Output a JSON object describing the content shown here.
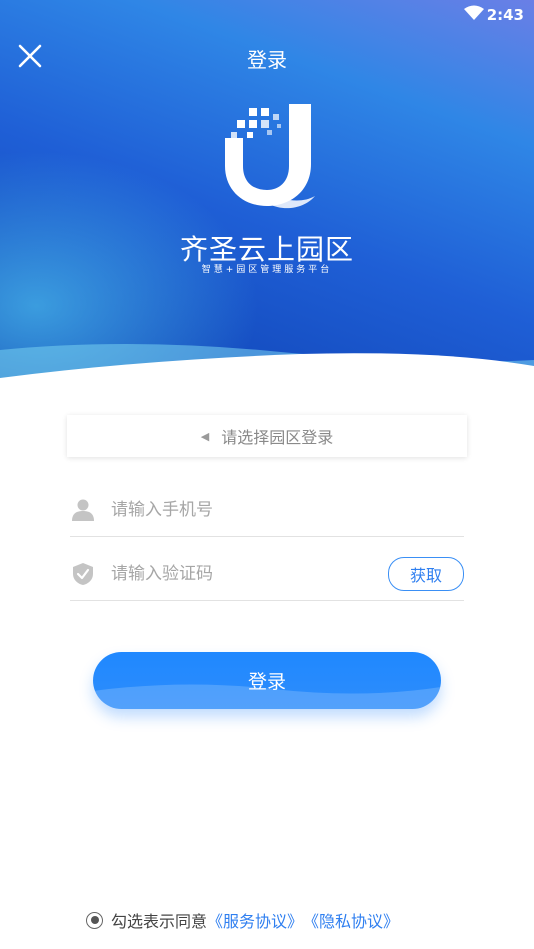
{
  "status_bar": {
    "time": "2:43",
    "wifi_icon": "wifi-icon"
  },
  "header": {
    "title": "登录",
    "close_icon": "close-icon",
    "brand_name": "齐圣云上园区",
    "brand_sub": "智慧+园区管理服务平台"
  },
  "form": {
    "park_select_placeholder": "请选择园区登录",
    "phone_placeholder": "请输入手机号",
    "code_placeholder": "请输入验证码",
    "get_code_label": "获取",
    "login_label": "登录"
  },
  "agreement": {
    "text": "勾选表示同意",
    "service_link": "《服务协议》",
    "privacy_link": "《隐私协议》"
  },
  "colors": {
    "primary": "#2f7ff0",
    "button": "#1f88ff",
    "header_dark": "#0d3fb0",
    "header_light": "#6a7fe6"
  }
}
